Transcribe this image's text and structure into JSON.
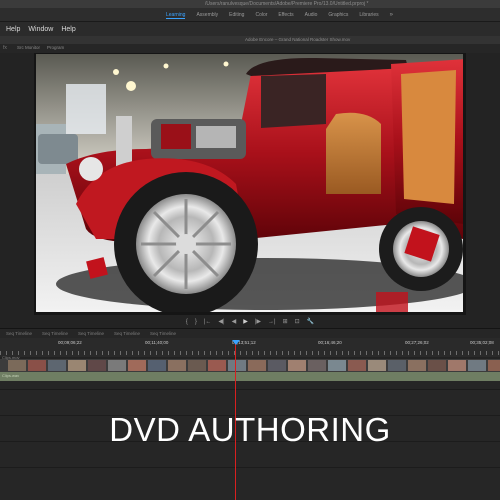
{
  "title_bar": {
    "path": "/Users/ranulvesque/Documents/Adobe/Premiere Pro/13.0/Untitled.prproj *"
  },
  "workspaces": {
    "tabs": [
      "Learning",
      "Assembly",
      "Editing",
      "Color",
      "Effects",
      "Audio",
      "Graphics",
      "Libraries"
    ],
    "active": "Learning",
    "more": "»"
  },
  "menu": {
    "items": [
      "Help",
      "Window",
      "Help"
    ]
  },
  "window_caption": "Adobe Encore – Grand National Roadster Show.mov",
  "panel_tabs": [
    "fx",
    "Src Monitor",
    "Program"
  ],
  "transport": {
    "buttons": [
      "{",
      "}",
      "|←",
      "◀|",
      "◀",
      "▶",
      "|▶",
      "→|",
      "⊞",
      "⊡",
      "🔧"
    ]
  },
  "timeline": {
    "tabs": [
      "Seq Timeline",
      "Seq Timeline",
      "Seq Timeline",
      "Seq Timeline",
      "Seq Timeline"
    ],
    "timecodes": [
      "00;09;06;22",
      "00;11;40;00",
      "00;13;51;12",
      "00;16;46;20",
      "00;27;26;02",
      "00;35;02;08"
    ],
    "clip_label": "Clips.mov",
    "audio_label": "Clips.wav"
  },
  "headline": "DVD AUTHORING",
  "colors": {
    "accent": "#3aa3ff",
    "playhead": "#d82020",
    "car_red": "#b0141c",
    "background": "#232323"
  }
}
